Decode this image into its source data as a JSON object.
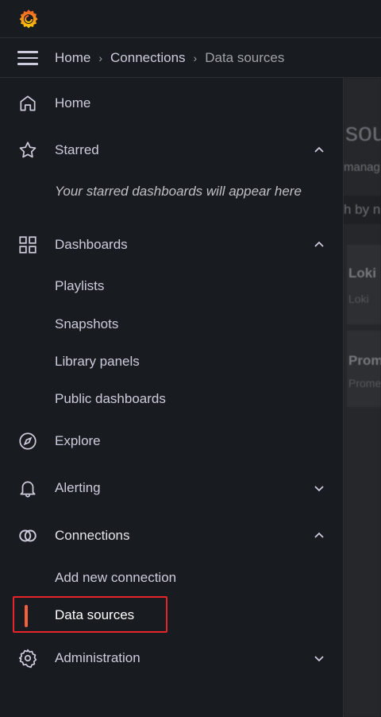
{
  "breadcrumb": {
    "items": [
      "Home",
      "Connections"
    ],
    "current": "Data sources"
  },
  "background": {
    "title_fragment": "sou",
    "subtitle_fragment": "manag",
    "search_fragment": "h by n",
    "cards": [
      {
        "name": "Loki",
        "type": "Loki"
      },
      {
        "name": "Prom",
        "type": "Prome"
      }
    ]
  },
  "nav": {
    "home": "Home",
    "starred": "Starred",
    "starred_hint": "Your starred dashboards will appear here",
    "dashboards": "Dashboards",
    "dashboards_children": [
      "Playlists",
      "Snapshots",
      "Library panels",
      "Public dashboards"
    ],
    "explore": "Explore",
    "alerting": "Alerting",
    "connections": "Connections",
    "connections_children": [
      "Add new connection",
      "Data sources"
    ],
    "administration": "Administration"
  },
  "colors": {
    "accent": "#f55f3e",
    "highlight": "#e8242b"
  }
}
